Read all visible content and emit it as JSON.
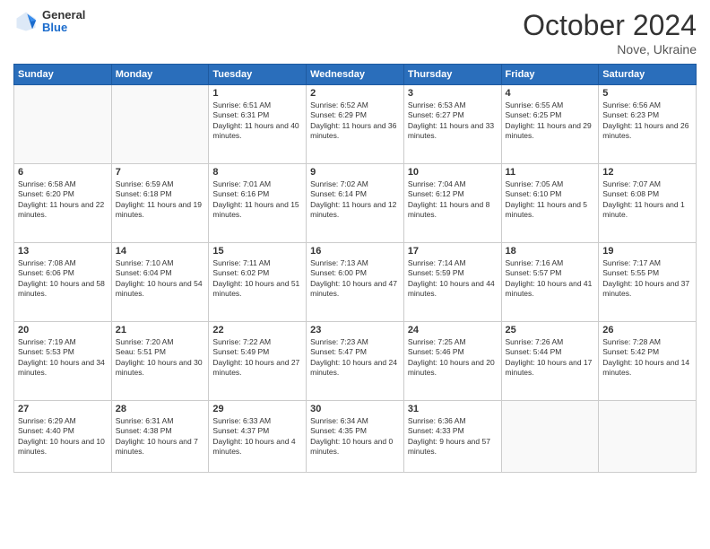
{
  "logo": {
    "general": "General",
    "blue": "Blue"
  },
  "header": {
    "month": "October 2024",
    "location": "Nove, Ukraine"
  },
  "days_of_week": [
    "Sunday",
    "Monday",
    "Tuesday",
    "Wednesday",
    "Thursday",
    "Friday",
    "Saturday"
  ],
  "weeks": [
    [
      {
        "day": "",
        "content": ""
      },
      {
        "day": "",
        "content": ""
      },
      {
        "day": "1",
        "content": "Sunrise: 6:51 AM\nSunset: 6:31 PM\nDaylight: 11 hours and 40 minutes."
      },
      {
        "day": "2",
        "content": "Sunrise: 6:52 AM\nSunset: 6:29 PM\nDaylight: 11 hours and 36 minutes."
      },
      {
        "day": "3",
        "content": "Sunrise: 6:53 AM\nSunset: 6:27 PM\nDaylight: 11 hours and 33 minutes."
      },
      {
        "day": "4",
        "content": "Sunrise: 6:55 AM\nSunset: 6:25 PM\nDaylight: 11 hours and 29 minutes."
      },
      {
        "day": "5",
        "content": "Sunrise: 6:56 AM\nSunset: 6:23 PM\nDaylight: 11 hours and 26 minutes."
      }
    ],
    [
      {
        "day": "6",
        "content": "Sunrise: 6:58 AM\nSunset: 6:20 PM\nDaylight: 11 hours and 22 minutes."
      },
      {
        "day": "7",
        "content": "Sunrise: 6:59 AM\nSunset: 6:18 PM\nDaylight: 11 hours and 19 minutes."
      },
      {
        "day": "8",
        "content": "Sunrise: 7:01 AM\nSunset: 6:16 PM\nDaylight: 11 hours and 15 minutes."
      },
      {
        "day": "9",
        "content": "Sunrise: 7:02 AM\nSunset: 6:14 PM\nDaylight: 11 hours and 12 minutes."
      },
      {
        "day": "10",
        "content": "Sunrise: 7:04 AM\nSunset: 6:12 PM\nDaylight: 11 hours and 8 minutes."
      },
      {
        "day": "11",
        "content": "Sunrise: 7:05 AM\nSunset: 6:10 PM\nDaylight: 11 hours and 5 minutes."
      },
      {
        "day": "12",
        "content": "Sunrise: 7:07 AM\nSunset: 6:08 PM\nDaylight: 11 hours and 1 minute."
      }
    ],
    [
      {
        "day": "13",
        "content": "Sunrise: 7:08 AM\nSunset: 6:06 PM\nDaylight: 10 hours and 58 minutes."
      },
      {
        "day": "14",
        "content": "Sunrise: 7:10 AM\nSunset: 6:04 PM\nDaylight: 10 hours and 54 minutes."
      },
      {
        "day": "15",
        "content": "Sunrise: 7:11 AM\nSunset: 6:02 PM\nDaylight: 10 hours and 51 minutes."
      },
      {
        "day": "16",
        "content": "Sunrise: 7:13 AM\nSunset: 6:00 PM\nDaylight: 10 hours and 47 minutes."
      },
      {
        "day": "17",
        "content": "Sunrise: 7:14 AM\nSunset: 5:59 PM\nDaylight: 10 hours and 44 minutes."
      },
      {
        "day": "18",
        "content": "Sunrise: 7:16 AM\nSunset: 5:57 PM\nDaylight: 10 hours and 41 minutes."
      },
      {
        "day": "19",
        "content": "Sunrise: 7:17 AM\nSunset: 5:55 PM\nDaylight: 10 hours and 37 minutes."
      }
    ],
    [
      {
        "day": "20",
        "content": "Sunrise: 7:19 AM\nSunset: 5:53 PM\nDaylight: 10 hours and 34 minutes."
      },
      {
        "day": "21",
        "content": "Sunrise: 7:20 AM\nSeau: 5:51 PM\nDaylight: 10 hours and 30 minutes."
      },
      {
        "day": "22",
        "content": "Sunrise: 7:22 AM\nSunset: 5:49 PM\nDaylight: 10 hours and 27 minutes."
      },
      {
        "day": "23",
        "content": "Sunrise: 7:23 AM\nSunset: 5:47 PM\nDaylight: 10 hours and 24 minutes."
      },
      {
        "day": "24",
        "content": "Sunrise: 7:25 AM\nSunset: 5:46 PM\nDaylight: 10 hours and 20 minutes."
      },
      {
        "day": "25",
        "content": "Sunrise: 7:26 AM\nSunset: 5:44 PM\nDaylight: 10 hours and 17 minutes."
      },
      {
        "day": "26",
        "content": "Sunrise: 7:28 AM\nSunset: 5:42 PM\nDaylight: 10 hours and 14 minutes."
      }
    ],
    [
      {
        "day": "27",
        "content": "Sunrise: 6:29 AM\nSunset: 4:40 PM\nDaylight: 10 hours and 10 minutes."
      },
      {
        "day": "28",
        "content": "Sunrise: 6:31 AM\nSunset: 4:38 PM\nDaylight: 10 hours and 7 minutes."
      },
      {
        "day": "29",
        "content": "Sunrise: 6:33 AM\nSunset: 4:37 PM\nDaylight: 10 hours and 4 minutes."
      },
      {
        "day": "30",
        "content": "Sunrise: 6:34 AM\nSunset: 4:35 PM\nDaylight: 10 hours and 0 minutes."
      },
      {
        "day": "31",
        "content": "Sunrise: 6:36 AM\nSunset: 4:33 PM\nDaylight: 9 hours and 57 minutes."
      },
      {
        "day": "",
        "content": ""
      },
      {
        "day": "",
        "content": ""
      }
    ]
  ]
}
